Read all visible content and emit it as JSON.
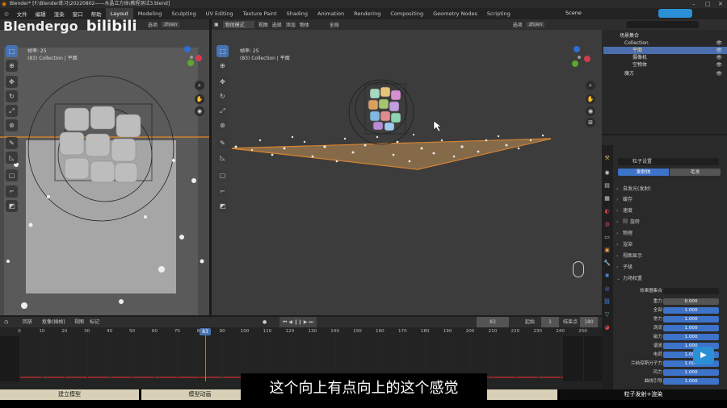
{
  "titlebar": {
    "text": "Blender* [F:\\Blender练习\\20220802——水晶立方体\\教程测试3.blend]"
  },
  "watermark": {
    "brand": "Blendergo",
    "logo": "bilibili"
  },
  "menu": [
    "文件",
    "编辑",
    "渲染",
    "窗口",
    "帮助"
  ],
  "workspaces": [
    "Layout",
    "Modeling",
    "Sculpting",
    "UV Editing",
    "Texture Paint",
    "Shading",
    "Animation",
    "Rendering",
    "Compositing",
    "Geometry Nodes",
    "Scripting"
  ],
  "scene_label": "Scene",
  "left_viewport": {
    "header": {
      "view": "视图",
      "select": "选择",
      "add": "添加",
      "object": "物体",
      "options": "选项",
      "lang": "zh/en"
    },
    "info_line1": "帧率: 25",
    "info_line2": "(83) Collection | 平面"
  },
  "right_viewport": {
    "header": {
      "mode": "物体模式",
      "view": "视图",
      "select": "选择",
      "add": "添加",
      "object": "物体",
      "transform": "全局",
      "options": "选项",
      "lang": "zh/en"
    },
    "info_line1": "帧率: 25",
    "info_line2": "(83) Collection | 平面"
  },
  "outliner": {
    "rows": [
      {
        "label": "场景集合",
        "indent": 0,
        "selected": false
      },
      {
        "label": "Collection",
        "indent": 1,
        "selected": false
      },
      {
        "label": "平面",
        "indent": 2,
        "selected": true
      },
      {
        "label": "摄像机",
        "indent": 2,
        "selected": false
      },
      {
        "label": "空物体",
        "indent": 2,
        "selected": false
      },
      {
        "label": "魔方",
        "indent": 1,
        "selected": false
      }
    ]
  },
  "properties": {
    "title": "粒子设置",
    "tab_emitter": "发射体",
    "tab_hair": "毛发",
    "sections": [
      "自发光(发射)",
      "缓存",
      "速度",
      "旋转",
      "物理",
      "渲染",
      "视图显示",
      "子级",
      "力场权重"
    ],
    "field_weights": {
      "collection_label": "效果器集合",
      "rows": [
        {
          "label": "重力",
          "value": "0.000",
          "dark": true
        },
        {
          "label": "全部",
          "value": "1.000"
        },
        {
          "label": "常力",
          "value": "1.000"
        },
        {
          "label": "涡流",
          "value": "1.000"
        },
        {
          "label": "磁力",
          "value": "1.000"
        },
        {
          "label": "谐波",
          "value": "1.000"
        },
        {
          "label": "电荷",
          "value": "1.000"
        },
        {
          "label": "兰纳琼斯分子力",
          "value": "1.000"
        },
        {
          "label": "风力",
          "value": "1.000"
        },
        {
          "label": "曲线引导",
          "value": "1.000"
        }
      ]
    }
  },
  "timeline": {
    "playback": "回放",
    "keying": "抠像(插帧)",
    "view": "视图",
    "marker": "标记",
    "current_frame": "83",
    "start_label": "起始",
    "start": "1",
    "end_label": "结束点",
    "end": "180",
    "ticks": [
      "0",
      "10",
      "20",
      "30",
      "40",
      "50",
      "60",
      "70",
      "80",
      "90",
      "100",
      "110",
      "120",
      "130",
      "140",
      "150",
      "160",
      "170",
      "180",
      "190",
      "200",
      "210",
      "220",
      "230",
      "240",
      "250"
    ],
    "playhead": "83"
  },
  "chapters": [
    "建立模型",
    "模型动画",
    "粒子发射+渲染"
  ],
  "subtitle": "这个向上有点向上的这个感觉"
}
